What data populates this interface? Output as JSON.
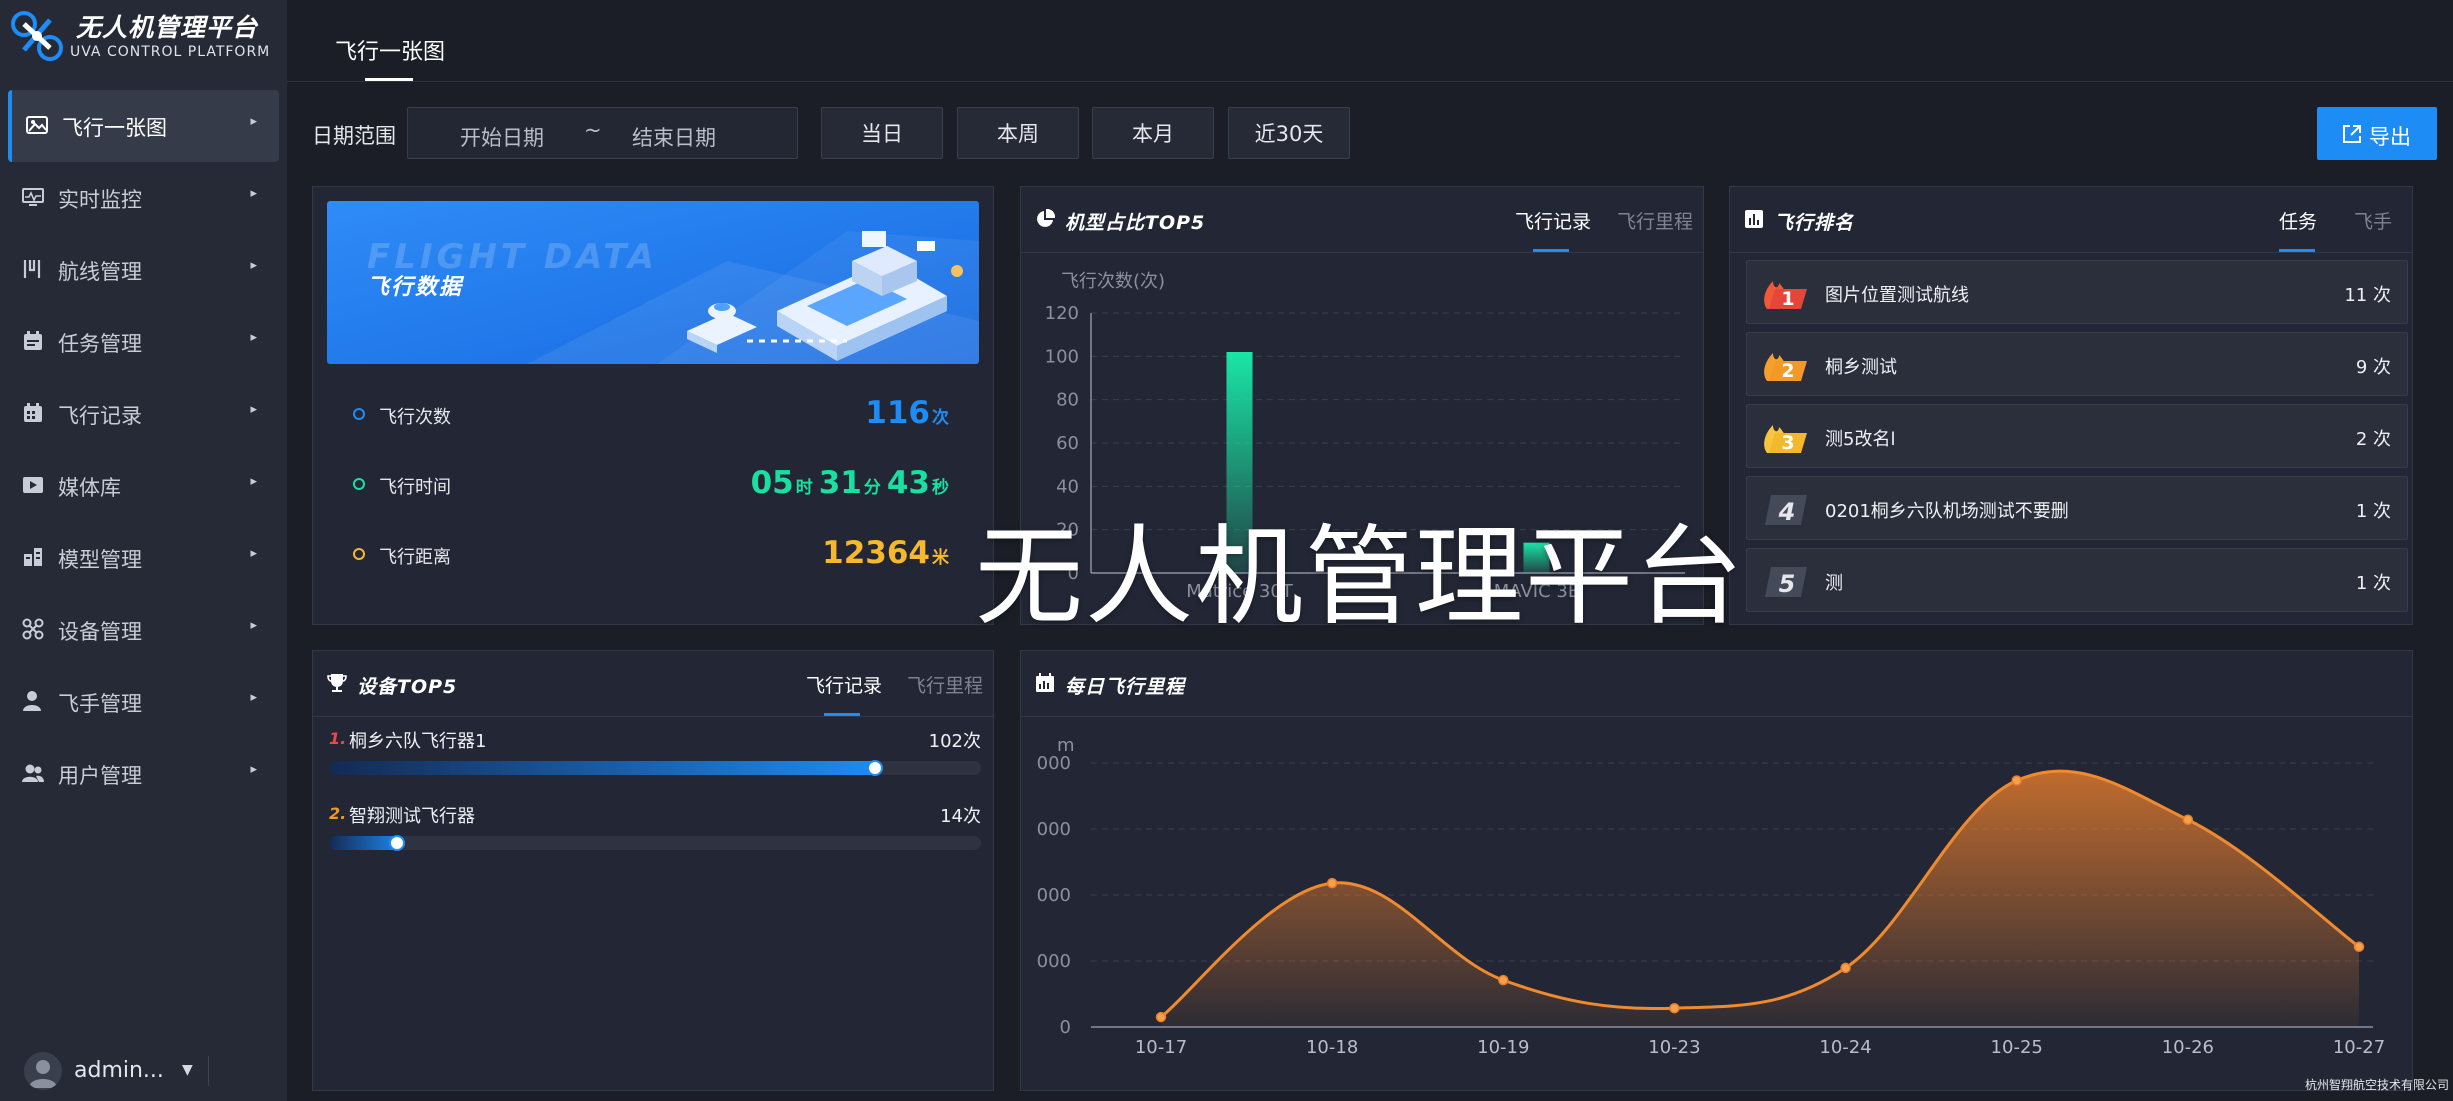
{
  "app": {
    "title": "无人机管理平台",
    "subtitle": "UVA CONTROL PLATFORM",
    "watermark": "无人机管理平台",
    "company": "杭州智翔航空技术有限公司"
  },
  "colors": {
    "accent": "#1e8cf5",
    "green": "#19e0a0",
    "gold": "#f5b82e",
    "orange": "#e87d2c",
    "red": "#e94b4b"
  },
  "sidebar": {
    "items": [
      {
        "label": "飞行一张图",
        "icon": "map-image-icon"
      },
      {
        "label": "实时监控",
        "icon": "monitor-icon"
      },
      {
        "label": "航线管理",
        "icon": "route-icon"
      },
      {
        "label": "任务管理",
        "icon": "calendar-icon"
      },
      {
        "label": "飞行记录",
        "icon": "record-icon"
      },
      {
        "label": "媒体库",
        "icon": "media-icon"
      },
      {
        "label": "模型管理",
        "icon": "model-icon"
      },
      {
        "label": "设备管理",
        "icon": "drone-icon"
      },
      {
        "label": "飞手管理",
        "icon": "pilot-icon"
      },
      {
        "label": "用户管理",
        "icon": "users-icon"
      }
    ],
    "user": {
      "name": "admin..."
    }
  },
  "tabs": {
    "main": "飞行一张图"
  },
  "filter": {
    "label": "日期范围",
    "start_placeholder": "开始日期",
    "separator": "~",
    "end_placeholder": "结束日期",
    "quick": [
      "当日",
      "本周",
      "本月",
      "近30天"
    ],
    "export": "导出"
  },
  "flight_data": {
    "banner_title": "飞行数据",
    "banner_ghost": "FLIGHT DATA",
    "count_label": "飞行次数",
    "count_value": "116",
    "count_unit": "次",
    "time_label": "飞行时间",
    "time_h": "05",
    "time_h_unit": "时",
    "time_m": "31",
    "time_m_unit": "分",
    "time_s": "43",
    "time_s_unit": "秒",
    "dist_label": "飞行距离",
    "dist_value": "12364",
    "dist_unit": "米"
  },
  "model_top": {
    "title": "机型占比TOP5",
    "tab_active": "飞行记录",
    "tab_other": "飞行里程"
  },
  "ranking": {
    "title": "飞行排名",
    "tab_active": "任务",
    "tab_other": "飞手",
    "rows": [
      {
        "rank": "1",
        "name": "图片位置测试航线",
        "count": "11 次"
      },
      {
        "rank": "2",
        "name": "桐乡测试",
        "count": "9 次"
      },
      {
        "rank": "3",
        "name": "测5改名l",
        "count": "2 次"
      },
      {
        "rank": "4",
        "name": "0201桐乡六队机场测试不要删",
        "count": "1 次"
      },
      {
        "rank": "5",
        "name": "测",
        "count": "1 次"
      }
    ]
  },
  "device_top": {
    "title": "设备TOP5",
    "tab_active": "飞行记录",
    "tab_other": "飞行里程",
    "rows": [
      {
        "idx": "1.",
        "name": "桐乡六队飞行器1",
        "count": "102次",
        "value": 102
      },
      {
        "idx": "2.",
        "name": "智翔测试飞行器",
        "count": "14次",
        "value": 14
      }
    ],
    "max": 120
  },
  "daily": {
    "title": "每日飞行里程"
  },
  "chart_data": [
    {
      "type": "bar",
      "ylabel": "飞行次数(次)",
      "categories": [
        "Matrice 30T",
        "MAVIC 3E"
      ],
      "values": [
        102,
        14
      ],
      "ylim": [
        0,
        120
      ],
      "yticks": [
        0,
        20,
        40,
        60,
        80,
        100,
        120
      ],
      "grid": true
    },
    {
      "type": "area",
      "ylabel": "m",
      "categories": [
        "10-17",
        "10-18",
        "10-19",
        "10-23",
        "10-24",
        "10-25",
        "10-26",
        "10-27"
      ],
      "values": [
        300,
        4360,
        1420,
        570,
        1790,
        7470,
        6280,
        2430
      ],
      "ylim": [
        0,
        8000
      ],
      "yticks": [
        "0",
        "000",
        "000",
        "000",
        "000"
      ],
      "grid": true
    }
  ]
}
